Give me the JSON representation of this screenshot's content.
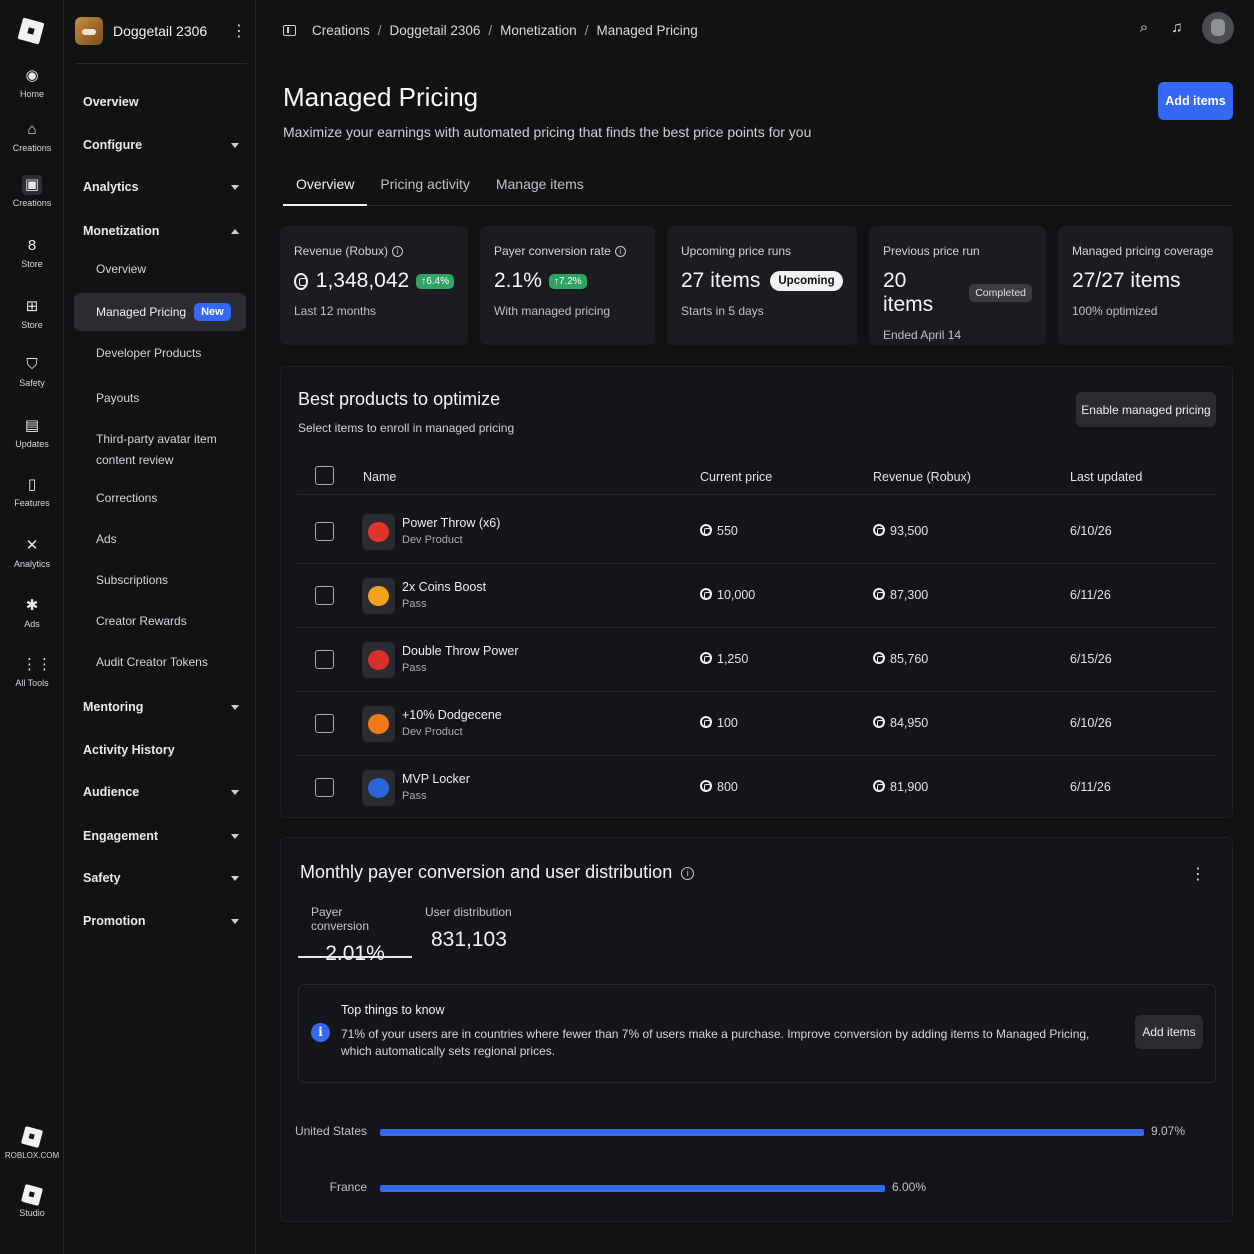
{
  "rail": {
    "items": [
      {
        "label": "Home",
        "icon": "home-icon"
      },
      {
        "label": "Creations",
        "icon": "creations-icon"
      },
      {
        "label": "Creations",
        "icon": "experience-icon"
      },
      {
        "label": "Store",
        "icon": "store-icon"
      },
      {
        "label": "Store",
        "icon": "store-bag-icon"
      },
      {
        "label": "Safety",
        "icon": "safety-icon"
      },
      {
        "label": "Updates",
        "icon": "updates-icon"
      },
      {
        "label": "Features",
        "icon": "features-icon"
      },
      {
        "label": "Analytics",
        "icon": "analytics-icon"
      },
      {
        "label": "Ads",
        "icon": "ads-icon"
      },
      {
        "label": "All Tools",
        "icon": "grid-icon"
      }
    ],
    "bottom": [
      {
        "label": "ROBLOX.COM",
        "icon": "roblox-logo-icon"
      },
      {
        "label": "Studio",
        "icon": "studio-icon"
      }
    ]
  },
  "sidebar": {
    "experience_name": "Doggetail 2306",
    "items": {
      "overview": "Overview",
      "configure": "Configure",
      "analytics": "Analytics",
      "monetization": "Monetization",
      "mentoring": "Mentoring",
      "activity_history": "Activity History",
      "audience": "Audience",
      "engagement": "Engagement",
      "safety": "Safety",
      "promotion": "Promotion"
    },
    "monetization_sub": {
      "overview": "Overview",
      "managed_pricing": "Managed Pricing",
      "new_badge": "New",
      "developer_products": "Developer Products",
      "payouts": "Payouts",
      "third_party": "Third-party avatar item content review",
      "corrections": "Corrections",
      "ads": "Ads",
      "subscriptions": "Subscriptions",
      "creator_rewards": "Creator Rewards",
      "audit_tokens": "Audit Creator Tokens"
    }
  },
  "breadcrumb": [
    "Creations",
    "Doggetail 2306",
    "Monetization",
    "Managed Pricing"
  ],
  "header": {
    "title": "Managed Pricing",
    "subtitle": "Maximize your earnings with automated pricing that finds the best price points for you",
    "add_items": "Add items"
  },
  "tabs": [
    "Overview",
    "Pricing activity",
    "Manage items"
  ],
  "stats": [
    {
      "label": "Revenue (Robux)",
      "value": "1,348,042",
      "chip": "↑6.4%",
      "foot": "Last 12 months"
    },
    {
      "label": "Payer conversion rate",
      "value": "2.1%",
      "chip": "↑7.2%",
      "foot": "With managed pricing"
    },
    {
      "label": "Upcoming price runs",
      "value": "27 items",
      "chip": "Upcoming",
      "foot": "Starts in 5 days"
    },
    {
      "label": "Previous price run",
      "value": "20 items",
      "chip": "Completed",
      "foot": "Ended April 14"
    },
    {
      "label": "Managed pricing coverage",
      "value": "27/27 items",
      "foot": "100% optimized"
    }
  ],
  "best_products": {
    "title": "Best products to optimize",
    "subtitle": "Select items to enroll in managed pricing",
    "enable_button": "Enable managed pricing",
    "columns": [
      "Name",
      "Current price",
      "Revenue (Robux)",
      "Last updated"
    ],
    "rows": [
      {
        "name": "Power Throw (x6)",
        "type": "Dev Product",
        "price": "550",
        "revenue": "93,500",
        "updated": "6/10/26",
        "color": "#e0342a"
      },
      {
        "name": "2x Coins Boost",
        "type": "Pass",
        "price": "10,000",
        "revenue": "87,300",
        "updated": "6/11/26",
        "color": "#f2a21b"
      },
      {
        "name": "Double Throw Power",
        "type": "Pass",
        "price": "1,250",
        "revenue": "85,760",
        "updated": "6/15/26",
        "color": "#d8302a"
      },
      {
        "name": "+10% Dodgecene",
        "type": "Dev Product",
        "price": "100",
        "revenue": "84,950",
        "updated": "6/10/26",
        "color": "#f07a17"
      },
      {
        "name": "MVP Locker",
        "type": "Pass",
        "price": "800",
        "revenue": "81,900",
        "updated": "6/11/26",
        "color": "#2a66d8"
      }
    ]
  },
  "conversion": {
    "title": "Monthly payer conversion and user distribution",
    "tabs": [
      {
        "label": "Payer conversion",
        "value": "2.01%"
      },
      {
        "label": "User distribution",
        "value": "831,103"
      }
    ],
    "notice": {
      "title": "Top things to know",
      "text": "71% of your users are in countries where fewer than 7% of users make a purchase. Improve conversion by adding items to Managed Pricing, which automatically sets regional prices.",
      "button": "Add items"
    },
    "bars": [
      {
        "country": "United States",
        "value": 9.07,
        "label": "9.07%"
      },
      {
        "country": "France",
        "value": 6.0,
        "label": "6.00%"
      }
    ],
    "bar_max": 9.5,
    "accent": "#3568f5"
  }
}
